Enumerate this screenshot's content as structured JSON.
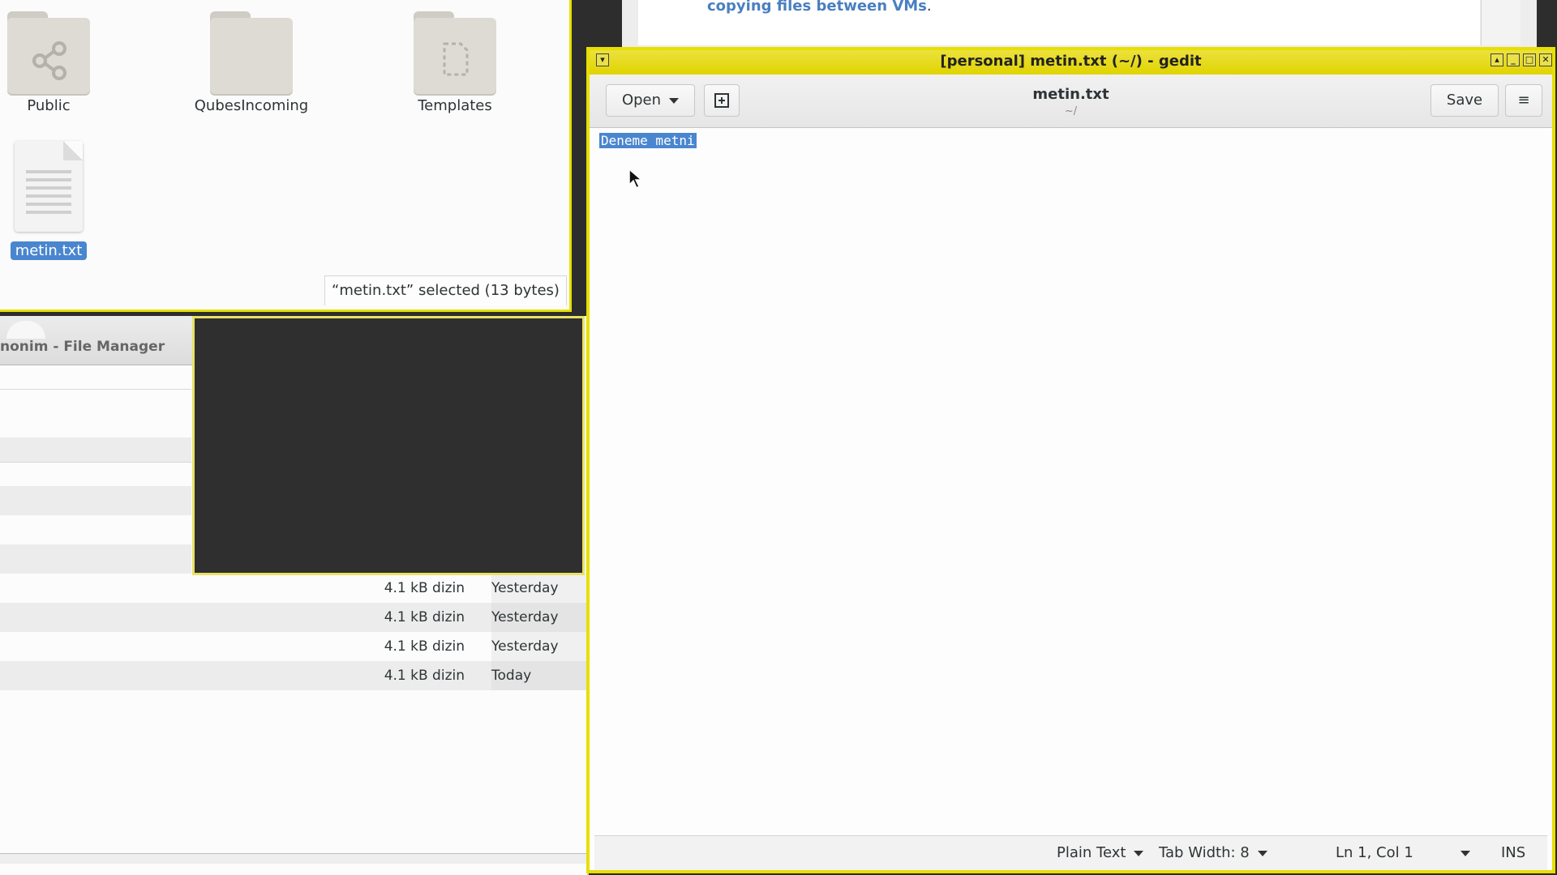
{
  "browser": {
    "link_text": "copying files between VMs",
    "trailing": "."
  },
  "file_manager_icons": {
    "items": [
      {
        "label": "Public",
        "icon": "folder-public-icon"
      },
      {
        "label": "QubesIncoming",
        "icon": "folder-icon"
      },
      {
        "label": "Templates",
        "icon": "folder-templates-icon"
      },
      {
        "label": "metin.txt",
        "icon": "text-file-icon",
        "selected": true
      }
    ],
    "status": "“metin.txt” selected  (13 bytes)"
  },
  "file_manager_list": {
    "title": "nonim - File Manager",
    "rows": [
      {
        "size": "4.1 kB dizin",
        "modified": "Yesterday"
      },
      {
        "size": "4.1 kB dizin",
        "modified": "Yesterday"
      },
      {
        "size": "4.1 kB dizin",
        "modified": "Yesterday"
      },
      {
        "size": "4.1 kB dizin",
        "modified": "Today"
      }
    ]
  },
  "gedit": {
    "window_title": "[personal] metin.txt (~/) - gedit",
    "open_label": "Open",
    "save_label": "Save",
    "doc_title": "metin.txt",
    "doc_path": "~/",
    "content": "Deneme metni",
    "status": {
      "language": "Plain Text",
      "tab_width": "Tab Width: 8",
      "position": "Ln 1, Col 1",
      "mode": "INS"
    }
  },
  "colors": {
    "qubes_personal_border": "#e6e000",
    "selection": "#4a86cf",
    "link": "#4a7fc0"
  }
}
